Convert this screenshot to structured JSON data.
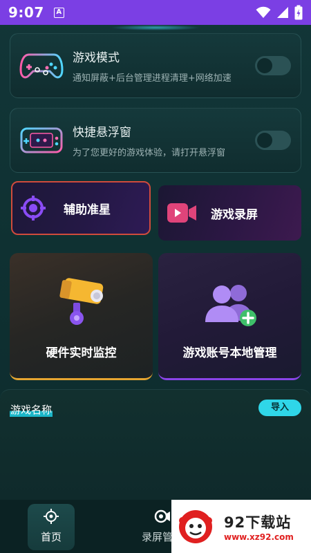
{
  "status_bar": {
    "time": "9:07",
    "notification_icon": "A"
  },
  "settings": [
    {
      "title": "游戏模式",
      "description": "通知屏蔽+后台管理进程清理+网络加速",
      "toggle_on": false,
      "icon": "gamepad-icon"
    },
    {
      "title": "快捷悬浮窗",
      "description": "为了您更好的游戏体验，请打开悬浮窗",
      "toggle_on": false,
      "icon": "handheld-console-icon"
    }
  ],
  "features": {
    "crosshair": {
      "label": "辅助准星",
      "icon": "crosshair-icon",
      "selected": true
    },
    "record": {
      "label": "游戏录屏",
      "icon": "video-camera-icon"
    },
    "monitor": {
      "label": "硬件实时监控",
      "icon": "surveillance-camera-icon"
    },
    "accounts": {
      "label": "游戏账号本地管理",
      "icon": "add-user-icon"
    }
  },
  "game_list": {
    "title": "游戏名称",
    "import_label": "导入"
  },
  "bottom_nav": {
    "items": [
      {
        "label": "首页",
        "icon": "crosshair-icon",
        "active": true
      },
      {
        "label": "录屏管理",
        "icon": "record-icon",
        "active": false
      }
    ]
  },
  "watermark": {
    "main": "92下载站",
    "sub": "www.xz92.com"
  },
  "colors": {
    "status_bar": "#7b3fe4",
    "background": "#0f3132",
    "selected_border": "#d04b3c",
    "accent_cyan": "#2fd6e8",
    "accent_purple": "#7a3cf0",
    "accent_pink": "#e0447a"
  }
}
